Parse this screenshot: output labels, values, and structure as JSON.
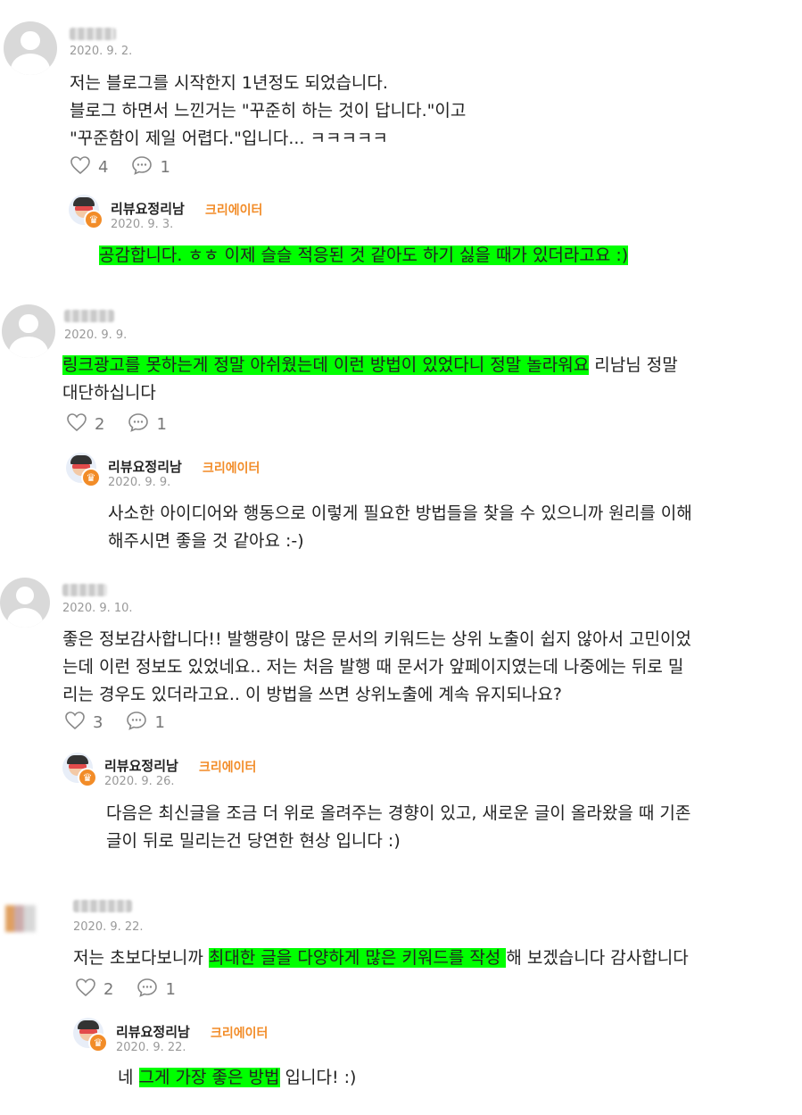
{
  "comments": [
    {
      "date": "2020. 9. 2.",
      "lines": [
        "저는 블로그를 시작한지 1년정도 되었습니다.",
        "블로그 하면서 느낀거는 \"꾸준히 하는 것이 답니다.\"이고",
        "\"꾸준함이 제일 어렵다.\"입니다... ㅋㅋㅋㅋㅋ"
      ],
      "likes": "4",
      "replies": "1",
      "reply": {
        "name": "리뷰요정리남",
        "badge": "크리에이터",
        "date": "2020. 9. 3.",
        "text": " 공감합니다. ㅎㅎ 이제 슬슬 적응된 것 같아도 하기 싫을 때가 있더라고요 :) "
      }
    },
    {
      "date": "2020. 9. 9.",
      "line1_hl": "링크광고를 못하는게 정말 아쉬웠는데 이런 방법이 있었다니 정말 놀라워요",
      "line1_rest": " 리남님 정말",
      "line2": "대단하십니다",
      "likes": "2",
      "replies": "1",
      "reply": {
        "name": "리뷰요정리남",
        "badge": "크리에이터",
        "date": "2020. 9. 9.",
        "lines": [
          "사소한 아이디어와 행동으로 이렇게 필요한 방법들을 찾을 수 있으니까 원리를 이해",
          "해주시면 좋을 것 같아요 :-)"
        ]
      }
    },
    {
      "date": "2020. 9. 10.",
      "lines": [
        "좋은 정보감사합니다!! 발행량이 많은 문서의 키워드는 상위 노출이 쉽지 않아서 고민이었",
        "는데 이런 정보도 있었네요.. 저는 처음 발행 때 문서가 앞페이지였는데 나중에는 뒤로 밀",
        "리는 경우도 있더라고요.. 이 방법을 쓰면 상위노출에 계속 유지되나요?"
      ],
      "likes": "3",
      "replies": "1",
      "reply": {
        "name": "리뷰요정리남",
        "badge": "크리에이터",
        "date": "2020. 9. 26.",
        "lines": [
          "다음은 최신글을 조금 더 위로 올려주는 경향이 있고, 새로운 글이 올라왔을 때 기존",
          "글이 뒤로 밀리는건 당연한 현상 입니다 :)"
        ]
      }
    },
    {
      "date": "2020. 9. 22.",
      "pre": "저는 초보다보니까 ",
      "hl": "최대한 글을 다양하게 많은 키워드를 작성 ",
      "post": "해 보겠습니다 감사합니다",
      "likes": "2",
      "replies": "1",
      "reply": {
        "name": "리뷰요정리남",
        "badge": "크리에이터",
        "date": "2020. 9. 22.",
        "pre": "네 ",
        "hl": "그게 가장 좋은 방법",
        "post": " 입니다! :)"
      }
    }
  ],
  "icons": {
    "like": "heart-icon",
    "reply": "speech-bubble-icon",
    "badge": "crown-icon"
  },
  "colors": {
    "highlight": "#00ff00",
    "badge": "#f28c28",
    "date": "#999999"
  }
}
